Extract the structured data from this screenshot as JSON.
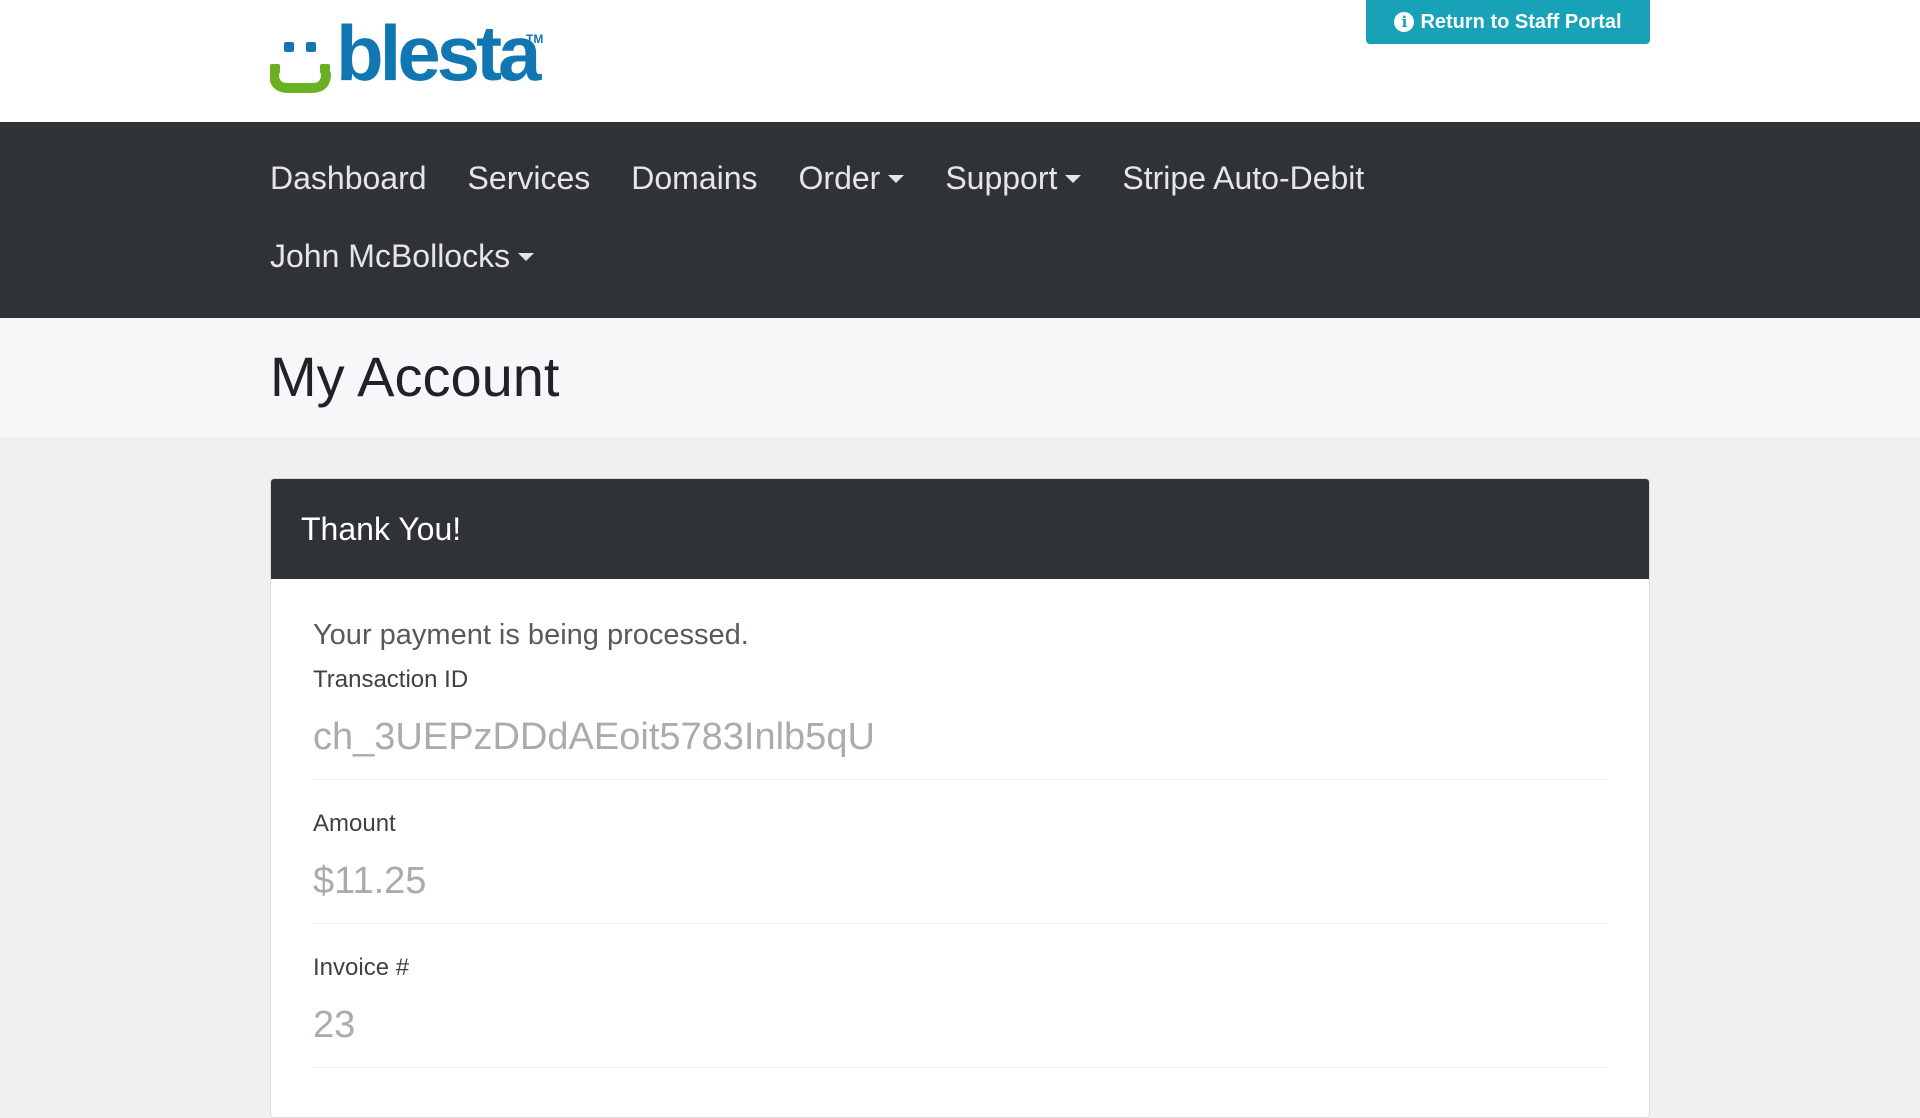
{
  "header": {
    "logo_text": "blesta",
    "logo_tm": "TM",
    "staff_portal_label": "Return to Staff Portal",
    "staff_portal_icon": "info-circle-icon"
  },
  "nav": {
    "items": [
      {
        "label": "Dashboard",
        "dropdown": false
      },
      {
        "label": "Services",
        "dropdown": false
      },
      {
        "label": "Domains",
        "dropdown": false
      },
      {
        "label": "Order",
        "dropdown": true
      },
      {
        "label": "Support",
        "dropdown": true
      },
      {
        "label": "Stripe Auto-Debit",
        "dropdown": false
      }
    ],
    "user_label": "John McBollocks"
  },
  "page": {
    "title": "My Account"
  },
  "panel": {
    "heading": "Thank You!",
    "message": "Your payment is being processed.",
    "fields": [
      {
        "label": "Transaction ID",
        "value": "ch_3UEPzDDdAEoit5783Inlb5qU"
      },
      {
        "label": "Amount",
        "value": "$11.25"
      },
      {
        "label": "Invoice #",
        "value": "23"
      }
    ]
  },
  "colors": {
    "navbar": "#2f3337",
    "accent": "#17a2b8",
    "logo_blue": "#1177b3",
    "logo_green": "#6ab023"
  }
}
